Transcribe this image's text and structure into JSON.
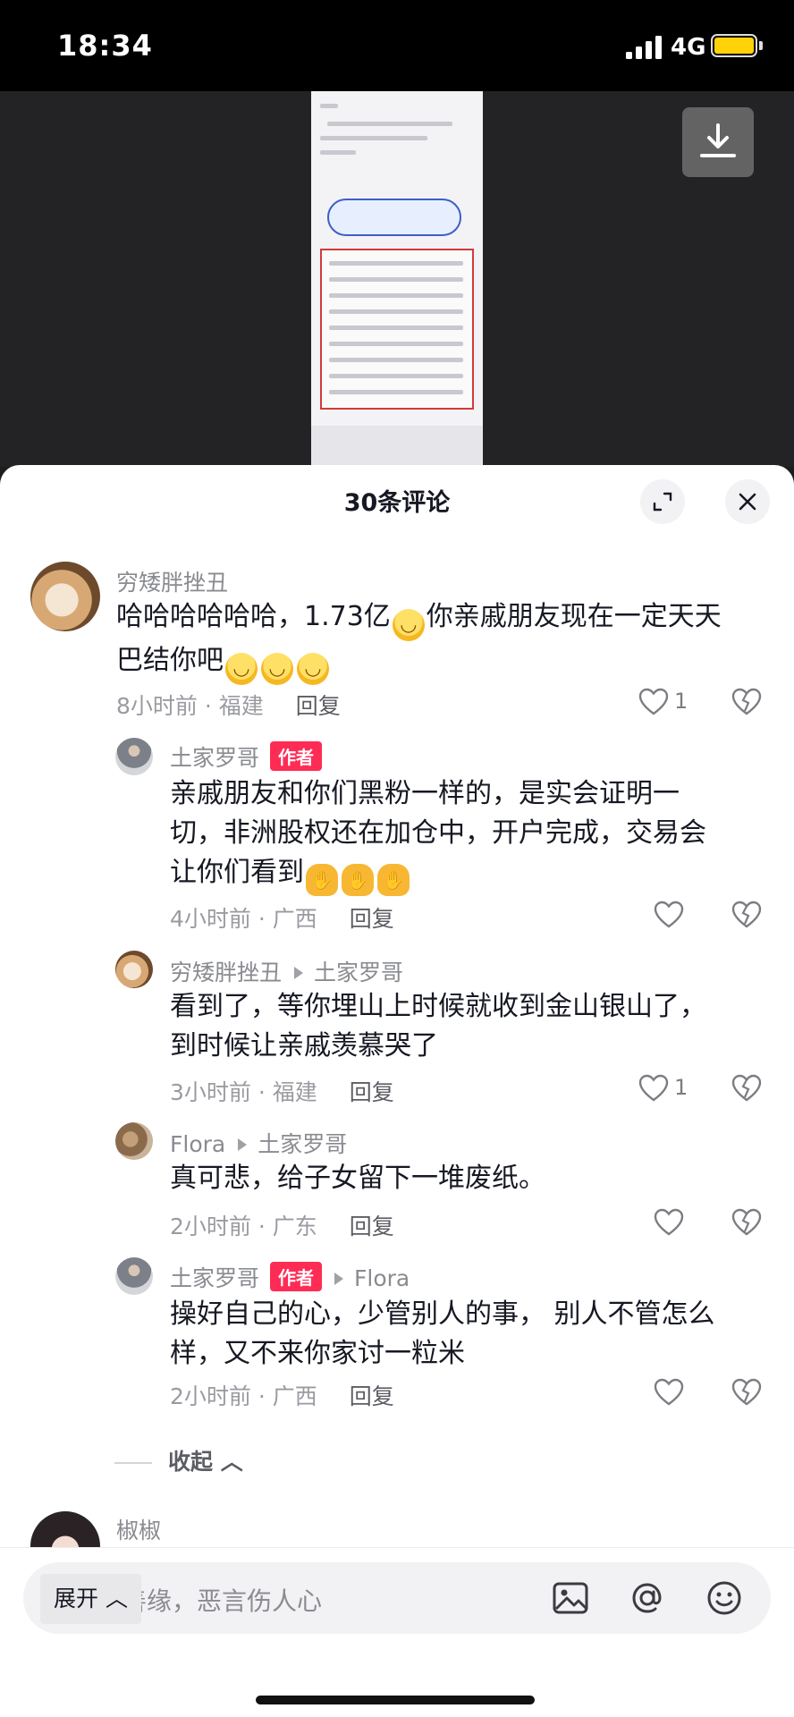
{
  "status_bar": {
    "time": "18:34",
    "network": "4G"
  },
  "sheet": {
    "title": "30条评论"
  },
  "comments": [
    {
      "user": "穷矮胖挫丑",
      "text_main": "哈哈哈哈哈哈，1.73亿",
      "text_tail": "你亲戚朋友现在一定天天",
      "text_line2": "巴结你吧",
      "meta": "8小时前 · 福建",
      "reply": "回复",
      "likes": "1"
    },
    {
      "user": "土家罗哥",
      "badge": "作者",
      "text_l1": "亲戚朋友和你们黑粉一样的，是实会证明一",
      "text_l2": "切，非洲股权还在加仓中，开户完成，交易会",
      "text_l3": "让你们看到",
      "meta": "4小时前 · 广西",
      "reply": "回复"
    },
    {
      "user": "穷矮胖挫丑",
      "reply_to": "土家罗哥",
      "text_l1": "看到了，等你埋山上时候就收到金山银山了，",
      "text_l2": "到时候让亲戚羡慕哭了",
      "meta": "3小时前 · 福建",
      "reply": "回复",
      "likes": "1"
    },
    {
      "user": "Flora",
      "reply_to": "土家罗哥",
      "text_l1": "真可悲，给子女留下一堆废纸。",
      "meta": "2小时前 · 广东",
      "reply": "回复"
    },
    {
      "user": "土家罗哥",
      "badge": "作者",
      "reply_to": "Flora",
      "text_l1": "操好自己的心，少管别人的事， 别人不管怎么",
      "text_l2": "样，又不来你家讨一粒米",
      "meta": "2小时前 · 广西",
      "reply": "回复"
    }
  ],
  "collapse": "收起",
  "next_user": "椒椒",
  "input": {
    "placeholder": "善语结善缘，恶言伤人心"
  },
  "expand": "展开",
  "colors": {
    "author_badge": "#fe2c55",
    "battery": "#ffd20a"
  },
  "icons": [
    "signal-icon",
    "battery-icon",
    "download-icon",
    "fullscreen-icon",
    "close-icon",
    "heart-icon",
    "dislike-icon",
    "image-icon",
    "at-icon",
    "emoji-icon"
  ]
}
